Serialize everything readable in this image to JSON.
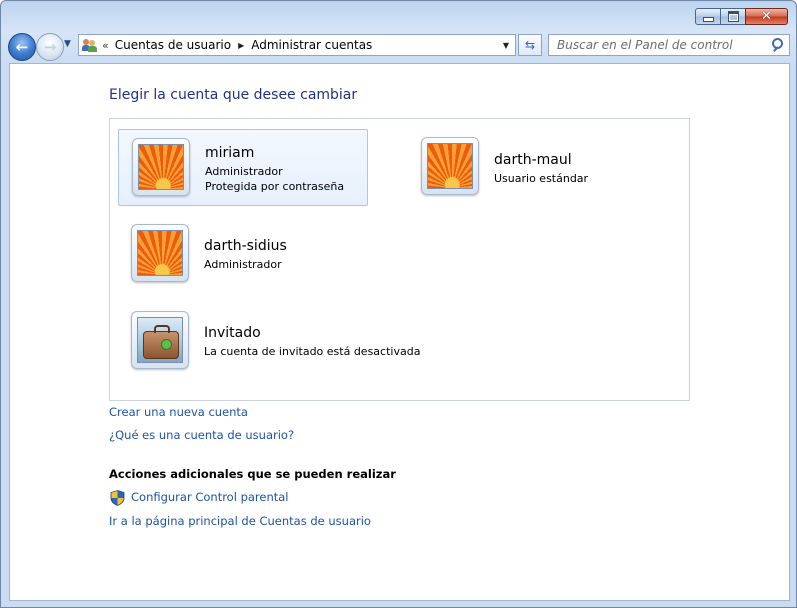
{
  "window": {
    "caption_buttons": [
      "minimize",
      "maximize",
      "close"
    ]
  },
  "nav": {
    "address": {
      "overflow": "«",
      "crumbs": [
        "Cuentas de usuario",
        "Administrar cuentas"
      ],
      "icon": "users-icon"
    },
    "search_placeholder": "Buscar en el Panel de control"
  },
  "content": {
    "heading": "Elegir la cuenta que desee cambiar",
    "accounts": [
      {
        "name": "miriam",
        "lines": [
          "Administrador",
          "Protegida por contraseña"
        ],
        "picture": "flower",
        "selected": true
      },
      {
        "name": "darth-maul",
        "lines": [
          "Usuario estándar"
        ],
        "picture": "flower",
        "selected": false
      },
      {
        "name": "darth-sidius",
        "lines": [
          "Administrador"
        ],
        "picture": "flower",
        "selected": false
      },
      {
        "name": "Invitado",
        "lines": [
          "La cuenta de invitado está desactivada"
        ],
        "picture": "suitcase",
        "selected": false
      }
    ],
    "links": {
      "create_account": "Crear una nueva cuenta",
      "what_is_account": "¿Qué es una cuenta de usuario?"
    },
    "additional": {
      "title": "Acciones adicionales que se pueden realizar",
      "parental_control": "Configurar Control parental",
      "main_page": "Ir a la página principal de Cuentas de usuario"
    }
  },
  "colors": {
    "link": "#1e53a4",
    "heading": "#1e3287",
    "selection": "#e6f0fc"
  }
}
